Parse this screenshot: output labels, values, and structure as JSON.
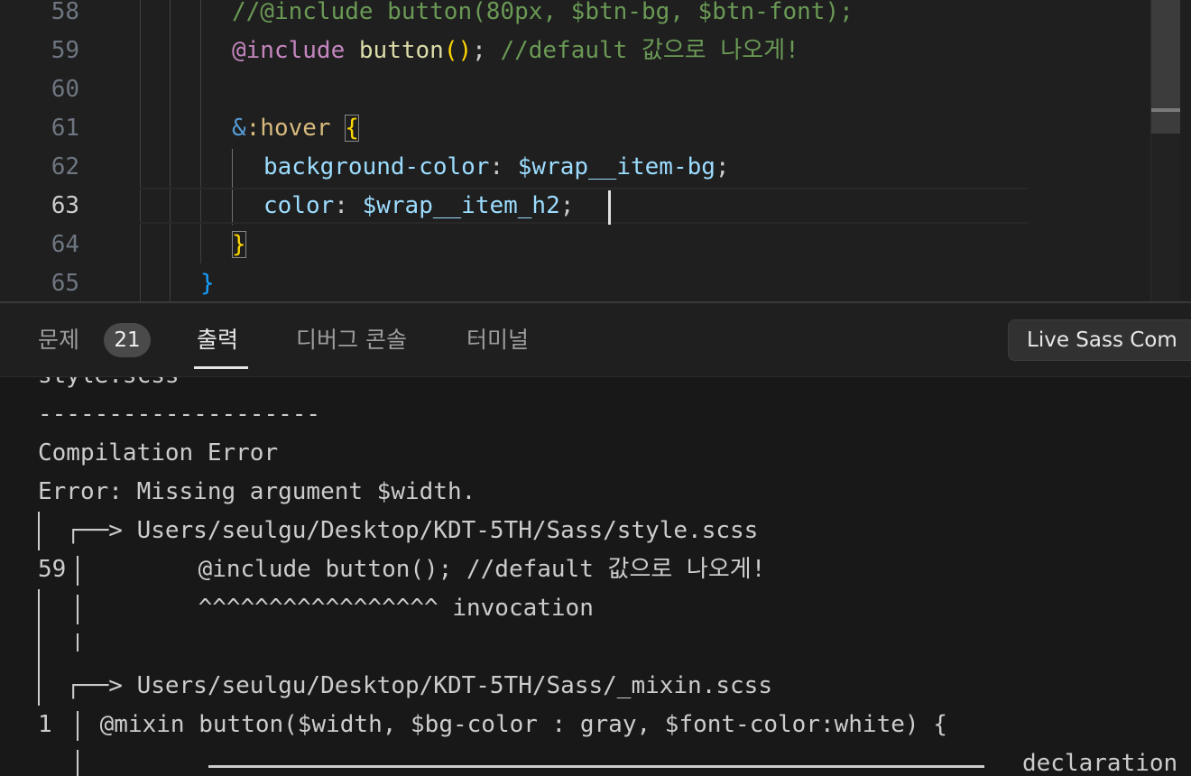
{
  "editor": {
    "line_numbers": [
      "58",
      "59",
      "60",
      "61",
      "62",
      "63",
      "64",
      "65"
    ],
    "active_line": "63",
    "lines": {
      "l58": {
        "comment": "//@include button(80px, $btn-bg, $btn-font);"
      },
      "l59": {
        "at": "@include",
        "fn": "button",
        "open": "(",
        "close": ")",
        "semi": ";",
        "comment": "//default 값으로 나오게!"
      },
      "l61": {
        "amp": "&",
        "pseudo": ":hover",
        "brace": "{"
      },
      "l62": {
        "prop": "background-color",
        "colon": ": ",
        "var": "$wrap__item-bg",
        "semi": ";"
      },
      "l63": {
        "prop": "color",
        "colon": ": ",
        "var": "$wrap__item_h2",
        "semi": ";"
      },
      "l64": {
        "brace": "}"
      },
      "l65": {
        "brace": "}"
      }
    }
  },
  "panel": {
    "tabs": [
      {
        "label": "문제"
      },
      {
        "label": "출력"
      },
      {
        "label": "디버그 콘솔"
      },
      {
        "label": "터미널"
      }
    ],
    "problems_count": "21",
    "active_tab": "출력",
    "output_channel": "Live Sass Com"
  },
  "output": {
    "lines": [
      "style.scss",
      "--------------------",
      "Compilation Error",
      "Error: Missing argument $width.",
      "  ┌──> Users/seulgu/Desktop/KDT-5TH/Sass/style.scss",
      "59",
      "       @include button(); //default 값으로 나오게!",
      "       ^^^^^^^^^^^^^^^^^ invocation",
      "",
      "  ┌──> Users/seulgu/Desktop/KDT-5TH/Sass/_mixin.scss",
      "1",
      " @mixin button($width, $bg-color : gray, $font-color:white) {",
      "declaration"
    ]
  },
  "colors": {
    "background": "#1f1f1f",
    "output_background": "#181818",
    "comment": "#6a9955",
    "keyword": "#c586c0",
    "function": "#dcdcaa",
    "property": "#9cdcfe",
    "brace_yellow": "#ffd700",
    "brace_blue": "#179fff"
  }
}
